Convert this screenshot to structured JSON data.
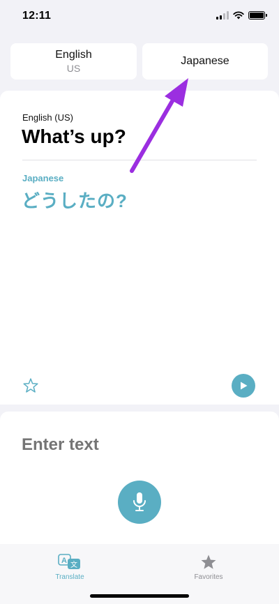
{
  "status_bar": {
    "time": "12:11"
  },
  "language_selector": {
    "source": {
      "name": "English",
      "region": "US"
    },
    "target": {
      "name": "Japanese"
    }
  },
  "translation": {
    "source_label": "English (US)",
    "source_text": "What’s up?",
    "target_label": "Japanese",
    "target_text": "どうしたの?"
  },
  "input": {
    "placeholder": "Enter text"
  },
  "tabs": [
    {
      "label": "Translate",
      "icon": "translate-icon",
      "active": true
    },
    {
      "label": "Favorites",
      "icon": "star-icon",
      "active": false
    }
  ],
  "colors": {
    "accent": "#5aaec3",
    "annotation_arrow": "#9b2ee0",
    "background": "#f2f2f7"
  }
}
